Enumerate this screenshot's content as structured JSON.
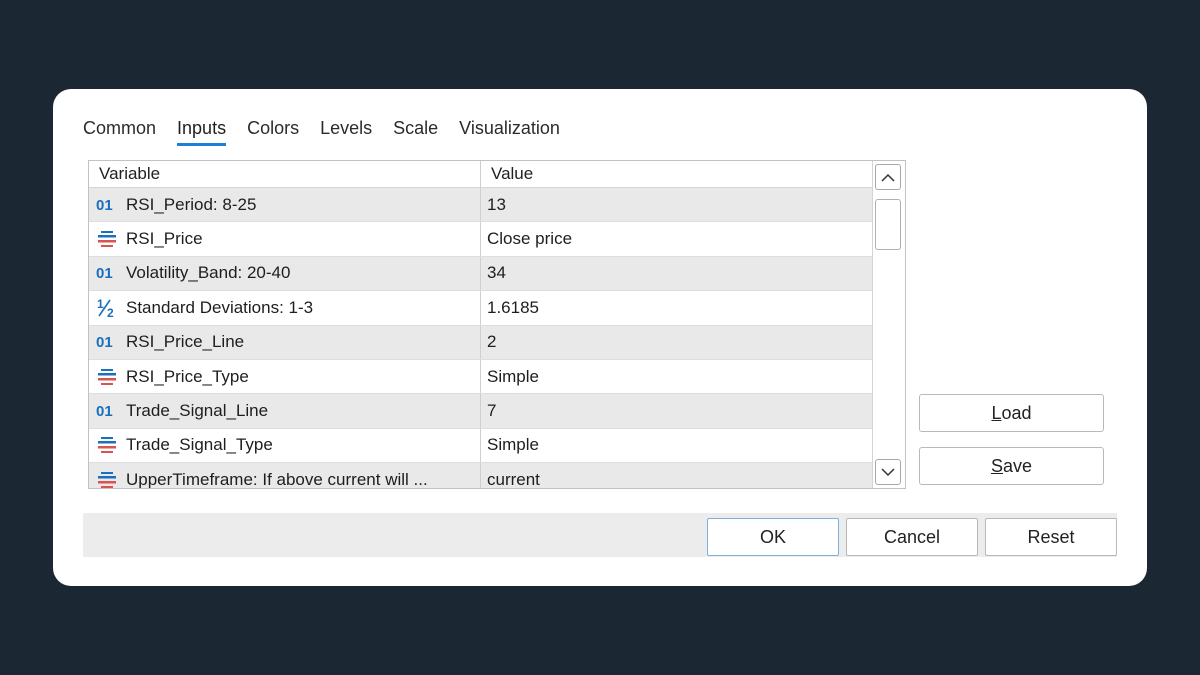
{
  "tabs": [
    {
      "label": "Common",
      "active": false
    },
    {
      "label": "Inputs",
      "active": true
    },
    {
      "label": "Colors",
      "active": false
    },
    {
      "label": "Levels",
      "active": false
    },
    {
      "label": "Scale",
      "active": false
    },
    {
      "label": "Visualization",
      "active": false
    }
  ],
  "grid": {
    "headers": {
      "variable": "Variable",
      "value": "Value"
    },
    "rows": [
      {
        "icon": "integer-icon",
        "variable": "RSI_Period: 8-25",
        "value": "13"
      },
      {
        "icon": "enum-icon",
        "variable": "RSI_Price",
        "value": "Close price"
      },
      {
        "icon": "integer-icon",
        "variable": "Volatility_Band: 20-40",
        "value": "34"
      },
      {
        "icon": "double-icon",
        "variable": "Standard Deviations: 1-3",
        "value": "1.6185"
      },
      {
        "icon": "integer-icon",
        "variable": "RSI_Price_Line",
        "value": "2"
      },
      {
        "icon": "enum-icon",
        "variable": "RSI_Price_Type",
        "value": "Simple"
      },
      {
        "icon": "integer-icon",
        "variable": "Trade_Signal_Line",
        "value": "7"
      },
      {
        "icon": "enum-icon",
        "variable": "Trade_Signal_Type",
        "value": "Simple"
      },
      {
        "icon": "enum-icon",
        "variable": "UpperTimeframe: If above current will ...",
        "value": "current"
      }
    ]
  },
  "side_buttons": {
    "load_first": "L",
    "load_rest": "oad",
    "save_first": "S",
    "save_rest": "ave"
  },
  "footer": {
    "ok": "OK",
    "cancel": "Cancel",
    "reset": "Reset"
  },
  "colors": {
    "accent": "#1d7fd6",
    "integer_icon": "#1a6fbf",
    "enum_top": "#1a6fbf",
    "enum_bottom": "#d9534f"
  }
}
